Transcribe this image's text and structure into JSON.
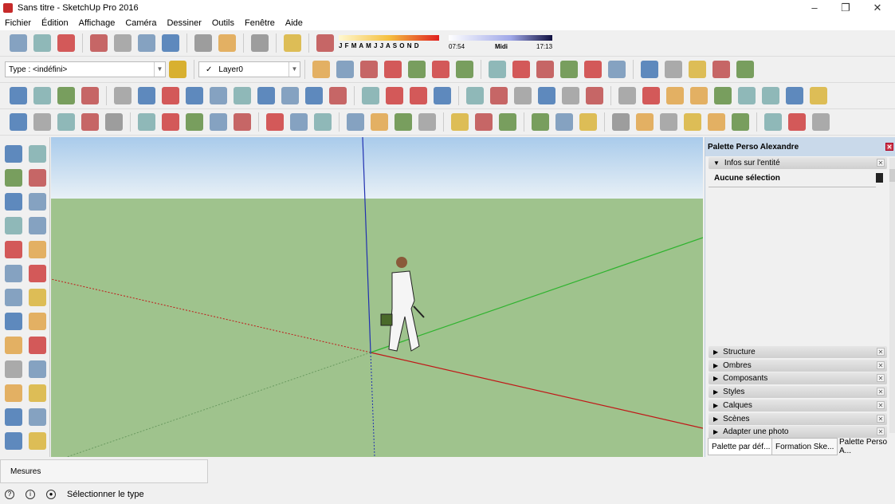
{
  "window": {
    "title": "Sans titre - SketchUp Pro 2016",
    "controls": [
      "–",
      "❐",
      "✕"
    ]
  },
  "menu": [
    "Fichier",
    "Édition",
    "Affichage",
    "Caméra",
    "Dessiner",
    "Outils",
    "Fenêtre",
    "Aide"
  ],
  "shadow": {
    "months": "J F M A M J J A S O N D",
    "time_start": "07:54",
    "time_mid": "Midi",
    "time_end": "17:13"
  },
  "type_combo": {
    "value": "Type : <indéfini>"
  },
  "layer_combo": {
    "check": "✓",
    "value": "Layer0"
  },
  "toolbars": {
    "row1": [
      "new",
      "open",
      "save",
      "|",
      "cut",
      "copy",
      "paste",
      "erase",
      "|",
      "undo",
      "redo",
      "|",
      "print",
      "|",
      "model-info",
      "|",
      "shadows"
    ],
    "row2": [
      "xray",
      "back-edges",
      "wireframe",
      "hidden-line",
      "shaded",
      "shaded-textures",
      "monochrome",
      "|",
      "iso",
      "top",
      "front",
      "right",
      "back",
      "left",
      "|",
      "component-a",
      "component-b",
      "component-c",
      "component-d",
      "component-e"
    ],
    "row3": [
      "select",
      "make-component",
      "paint-bucket",
      "eraser",
      "|",
      "line",
      "freehand",
      "rectangle",
      "rotated-rect",
      "circle",
      "polygon",
      "arc",
      "arc-2pt",
      "arc-3pt",
      "pie",
      "|",
      "push-pull",
      "follow-me",
      "offset",
      "move-copy",
      "|",
      "tape",
      "dimension",
      "protractor",
      "text",
      "axes",
      "3d-text",
      "|",
      "orbit",
      "pan",
      "zoom",
      "zoom-window",
      "zoom-extents",
      "previous",
      "position-camera",
      "look-around",
      "walk"
    ],
    "row4": [
      "select",
      "eraser",
      "freehand-dd",
      "arc-dd",
      "circle-dd",
      "|",
      "push-pull",
      "follow-me",
      "move",
      "rotate",
      "scale",
      "|",
      "tape",
      "text",
      "paint",
      "|",
      "orbit",
      "pan",
      "zoom",
      "zoom-extents",
      "|",
      "sandbox-a",
      "sandbox-b",
      "sandbox-c",
      "|",
      "section-plane",
      "section-display",
      "section-cut",
      "|",
      "move",
      "push",
      "rotate",
      "follow",
      "scale",
      "offset",
      "|",
      "warehouse",
      "extension",
      "share"
    ]
  },
  "left_toolbar": [
    "select",
    "make-component",
    "paint-bucket",
    "eraser",
    "line",
    "freehand",
    "rectangle",
    "rotated-rect",
    "circle",
    "polygon",
    "arc",
    "arc-2pt",
    "arc-3pt",
    "pie",
    "move",
    "push-pull",
    "rotate",
    "follow-me",
    "scale",
    "offset",
    "tape",
    "dimension",
    "protractor",
    "text",
    "axes",
    "3d-text"
  ],
  "panel": {
    "title": "Palette Perso Alexandre",
    "entity_tray": "Infos sur l'entité",
    "entity_status": "Aucune sélection",
    "trays": [
      "Structure",
      "Ombres",
      "Composants",
      "Styles",
      "Calques",
      "Scènes",
      "Adapter une photo"
    ],
    "tabs": [
      "Palette par déf...",
      "Formation Ske...",
      "Palette Perso A..."
    ]
  },
  "measures": {
    "label": "Mesures"
  },
  "status": {
    "text": "Sélectionner le type"
  },
  "colors": {
    "red_axis": "#c01818",
    "green_axis": "#2fb32f",
    "blue_axis": "#2030b0",
    "ground": "#9fc38d",
    "sky": "#c6dcf0"
  }
}
